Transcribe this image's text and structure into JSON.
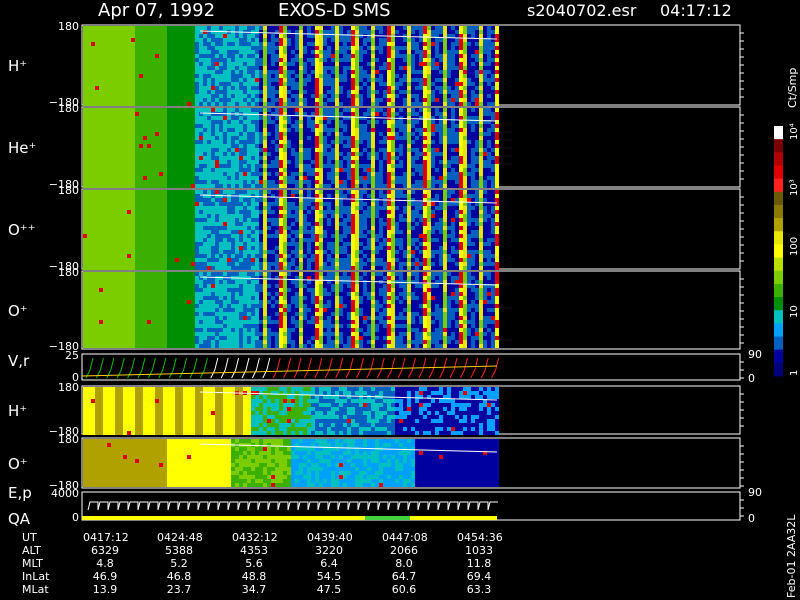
{
  "header": {
    "date": "Apr 07, 1992",
    "mission": "EXOS-D SMS",
    "file": "s2040702.esr",
    "time": "04:17:12"
  },
  "colorbar": {
    "unit": "Ct/Smp",
    "tick_labels": [
      "10⁴",
      "10³",
      "100",
      "10",
      "1"
    ],
    "colors": [
      "#ffffff",
      "#7a0000",
      "#b00000",
      "#e00000",
      "#ff2020",
      "#6b5a00",
      "#8b7a00",
      "#b0a000",
      "#e6e600",
      "#ffff00",
      "#b8e000",
      "#7ccd00",
      "#3cb000",
      "#008f00",
      "#00c0c0",
      "#00a0ff",
      "#0060c0",
      "#0000a0",
      "#00007a"
    ]
  },
  "panels": [
    {
      "label": "H⁺",
      "ytop": "180",
      "ybot": "−180",
      "kind": "pitch",
      "pattern": "sweep"
    },
    {
      "label": "He⁺",
      "ytop": "180",
      "ybot": "−180",
      "kind": "pitch",
      "pattern": "sweep"
    },
    {
      "label": "O⁺⁺",
      "ytop": "180",
      "ybot": "−180",
      "kind": "pitch",
      "pattern": "sweep"
    },
    {
      "label": "O⁺",
      "ytop": "180",
      "ybot": "−180",
      "kind": "pitch",
      "pattern": "sweep"
    },
    {
      "label": "V,r",
      "ytop": "25",
      "ybot": "0",
      "kind": "line",
      "right_top": "90",
      "right_bot": "0"
    },
    {
      "label": "H⁺",
      "ytop": "180",
      "ybot": "−180",
      "kind": "pitch",
      "pattern": "energy"
    },
    {
      "label": "O⁺",
      "ytop": "180",
      "ybot": "−180",
      "kind": "pitch",
      "pattern": "energy2"
    },
    {
      "label": "E,p",
      "label2": "QA",
      "ytop": "4000",
      "ybot": "0",
      "kind": "steps",
      "right_top": "90",
      "right_bot": "0"
    }
  ],
  "ephemeris": {
    "row_labels": [
      "UT",
      "ALT",
      "MLT",
      "InLat",
      "MLat"
    ],
    "columns": [
      [
        "0417:12",
        "6329",
        "4.8",
        "46.9",
        "13.9"
      ],
      [
        "0424:48",
        "5388",
        "5.2",
        "46.8",
        "23.7"
      ],
      [
        "0432:12",
        "4353",
        "5.6",
        "48.8",
        "34.7"
      ],
      [
        "0439:40",
        "3220",
        "6.4",
        "54.5",
        "47.5"
      ],
      [
        "0447:08",
        "2066",
        "8.0",
        "64.7",
        "60.6"
      ],
      [
        "0454:36",
        "1033",
        "11.8",
        "69.4",
        "63.3"
      ]
    ]
  },
  "footer": {
    "stamp": "Feb-01 2AA32L"
  },
  "chart_data": {
    "type": "heatmap",
    "title": "Apr 07, 1992   EXOS-D SMS",
    "x": [
      "0417:12",
      "0424:48",
      "0432:12",
      "0439:40",
      "0447:08",
      "0454:36"
    ],
    "xlabel": "UT",
    "ylabel": "",
    "panels_ylim": [
      [
        -180,
        180
      ],
      [
        -180,
        180
      ],
      [
        -180,
        180
      ],
      [
        -180,
        180
      ],
      [
        0,
        25
      ],
      [
        -180,
        180
      ],
      [
        -180,
        180
      ],
      [
        0,
        4000
      ]
    ],
    "colorbar": {
      "label": "Ct/Smp",
      "scale": "log",
      "ticks": [
        1,
        10,
        100,
        1000,
        10000
      ]
    },
    "ephemeris": {
      "ALT": [
        6329,
        5388,
        4353,
        3220,
        2066,
        1033
      ],
      "MLT": [
        4.8,
        5.2,
        5.6,
        6.4,
        8.0,
        11.8
      ],
      "InLat": [
        46.9,
        46.8,
        48.8,
        54.5,
        64.7,
        69.4
      ],
      "MLat": [
        13.9,
        23.7,
        34.7,
        47.5,
        60.6,
        63.3
      ]
    }
  }
}
